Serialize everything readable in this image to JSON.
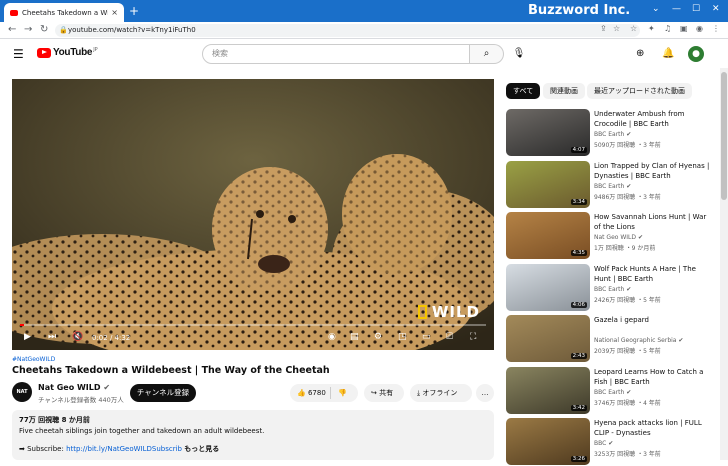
{
  "browser": {
    "tab_title": "Cheetahs Takedown a Wildebeest",
    "tab_close": "×",
    "new_tab": "+",
    "brand": "Buzzword Inc.",
    "url": "youtube.com/watch?v=kTny1iFuTh0",
    "window_controls": [
      "⌄",
      "—",
      "☐",
      "✕"
    ]
  },
  "header": {
    "logo_text": "YouTube",
    "logo_region": "JP",
    "search_placeholder": "検索",
    "avatar_letter": "●"
  },
  "player": {
    "watermark": "WILD",
    "time": "0:02 / 4:32",
    "progress": 0.008
  },
  "video": {
    "hashtag": "#NatGeoWILD",
    "title": "Cheetahs Takedown a Wildebeest | The Way of the Cheetah",
    "channel_avatar": "NAT GEO WILD",
    "channel": "Nat Geo WILD",
    "subscribers": "チャンネル登録者数 440万人",
    "subscribe_label": "チャンネル登録",
    "likes": "6780",
    "share_label": "共有",
    "offline_label": "オフライン",
    "more_label": "…"
  },
  "description": {
    "meta": "77万 回視聴  8 か月前",
    "text": "Five cheetah siblings join together and takedown an adult wildebeest.",
    "subscribe_prefix": "➡ Subscribe: ",
    "subscribe_link": "http://bit.ly/NatGeoWILDSubscrib",
    "more": "もっと見る"
  },
  "chips": [
    "すべて",
    "関連動画",
    "最近アップロードされた動画"
  ],
  "related": [
    {
      "title": "Underwater Ambush from Crocodile | BBC Earth",
      "channel": "BBC Earth",
      "meta": "5090万 回視聴 ・3 年前",
      "duration": "4:07",
      "colors": [
        "#6e6a66",
        "#2a2a2a"
      ]
    },
    {
      "title": "Lion Trapped by Clan of Hyenas | Dynasties | BBC Earth",
      "channel": "BBC Earth",
      "meta": "9486万 回視聴 ・3 年前",
      "duration": "3:34",
      "colors": [
        "#9aa145",
        "#6b5a2e"
      ]
    },
    {
      "title": "How Savannah Lions Hunt | War of the Lions",
      "channel": "Nat Geo WILD",
      "meta": "1万 回視聴 ・9 か月前",
      "duration": "4:35",
      "colors": [
        "#b58346",
        "#7a4e24"
      ]
    },
    {
      "title": "Wolf Pack Hunts A Hare | The Hunt | BBC Earth",
      "channel": "BBC Earth",
      "meta": "2426万 回視聴 ・5 年前",
      "duration": "4:06",
      "colors": [
        "#d7dde3",
        "#8a9198"
      ]
    },
    {
      "title": "Gazela i gepard",
      "channel": "National Geographic Serbia",
      "meta": "2039万 回視聴 ・5 年前",
      "duration": "2:43",
      "colors": [
        "#a38a5a",
        "#6f5b3a"
      ]
    },
    {
      "title": "Leopard Learns How to Catch a Fish | BBC Earth",
      "channel": "BBC Earth",
      "meta": "3746万 回視聴 ・4 年前",
      "duration": "3:42",
      "colors": [
        "#8a8560",
        "#3e3a2a"
      ]
    },
    {
      "title": "Hyena pack attacks lion | FULL CLIP - Dynasties",
      "channel": "BBC",
      "meta": "3253万 回視聴 ・3 年前",
      "duration": "3:26",
      "colors": [
        "#9b7a45",
        "#4f3a1f"
      ]
    }
  ]
}
